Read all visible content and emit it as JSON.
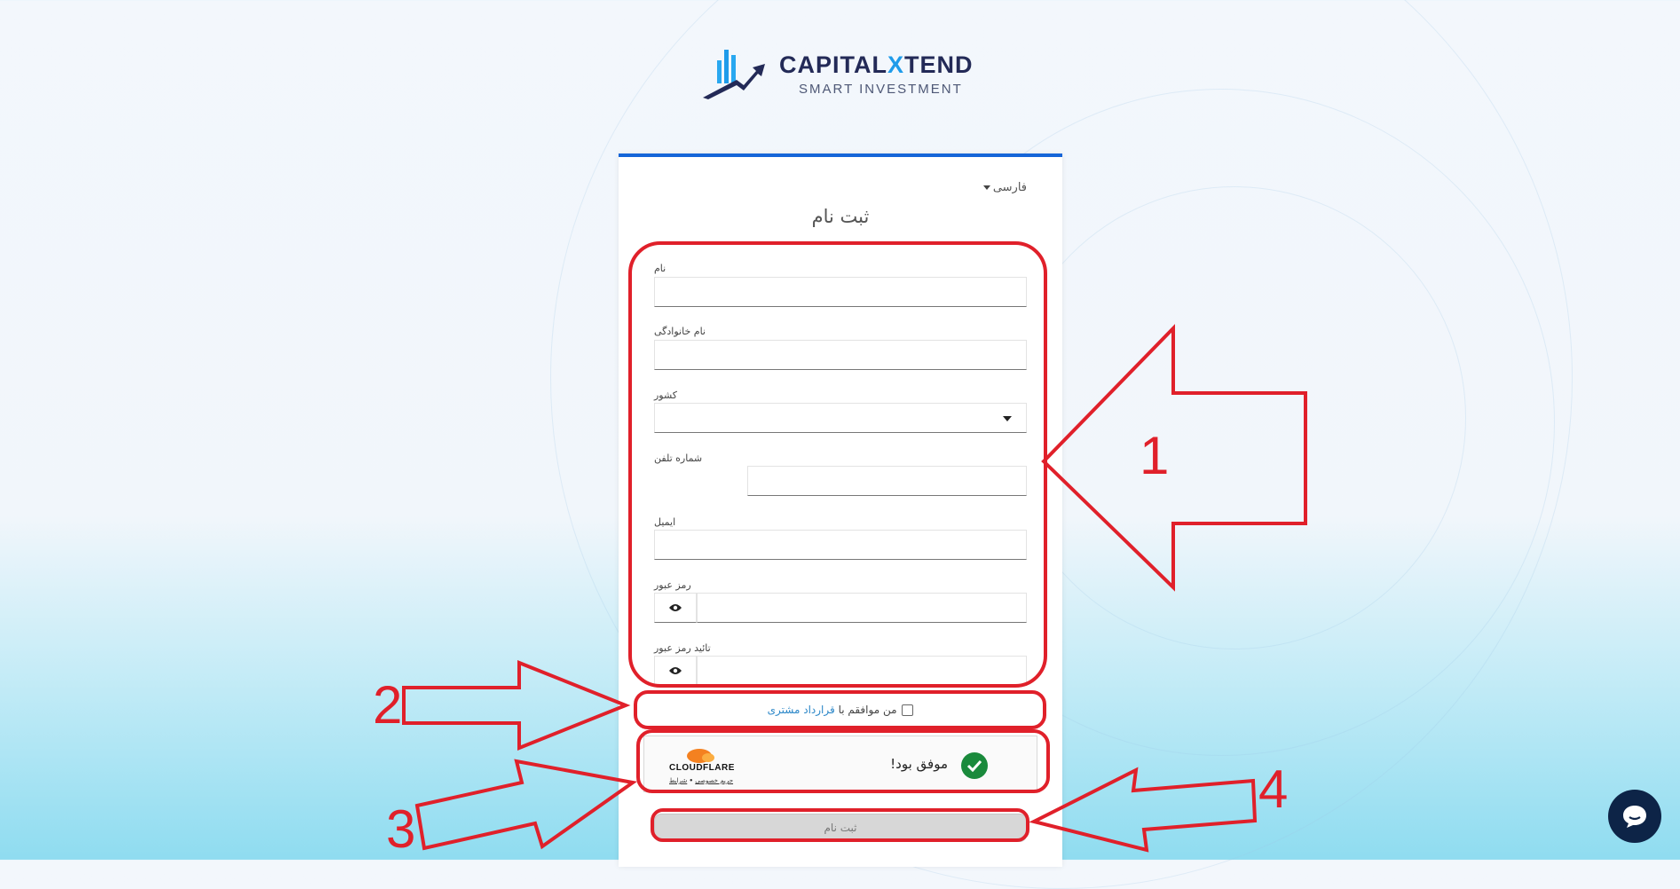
{
  "brand": {
    "name_part1": "CAPITAL",
    "name_x": "X",
    "name_part2": "TEND",
    "tagline": "SMART INVESTMENT"
  },
  "form": {
    "language": "فارسی",
    "title": "ثبت نام",
    "fields": {
      "first_name": {
        "label": "نام",
        "value": ""
      },
      "last_name": {
        "label": "نام خانوادگی",
        "value": ""
      },
      "country": {
        "label": "کشور",
        "value": ""
      },
      "phone": {
        "label": "شماره تلفن",
        "value": ""
      },
      "email": {
        "label": "ایمیل",
        "value": ""
      },
      "password": {
        "label": "رمز عبور",
        "value": ""
      },
      "password_confirm": {
        "label": "تائید رمز عبور",
        "value": ""
      }
    },
    "agreement": {
      "text": "من موافقم با",
      "link": "قرارداد مشتری",
      "checked": false
    },
    "captcha": {
      "status": "موفق بود!",
      "provider": "CLOUDFLARE",
      "privacy_link": "حریم خصوصی",
      "separator": "•",
      "terms_link": "شرایط"
    },
    "submit_label": "ثبت نام"
  },
  "annotations": {
    "label_1": "1",
    "label_2": "2",
    "label_3": "3",
    "label_4": "4",
    "color": "#e0202a"
  },
  "colors": {
    "accent_bar": "#1565d8",
    "brand_navy": "#232a57",
    "brand_blue": "#1e9bea",
    "success_green": "#1a8a3c",
    "cloudflare_orange": "#f48120"
  }
}
